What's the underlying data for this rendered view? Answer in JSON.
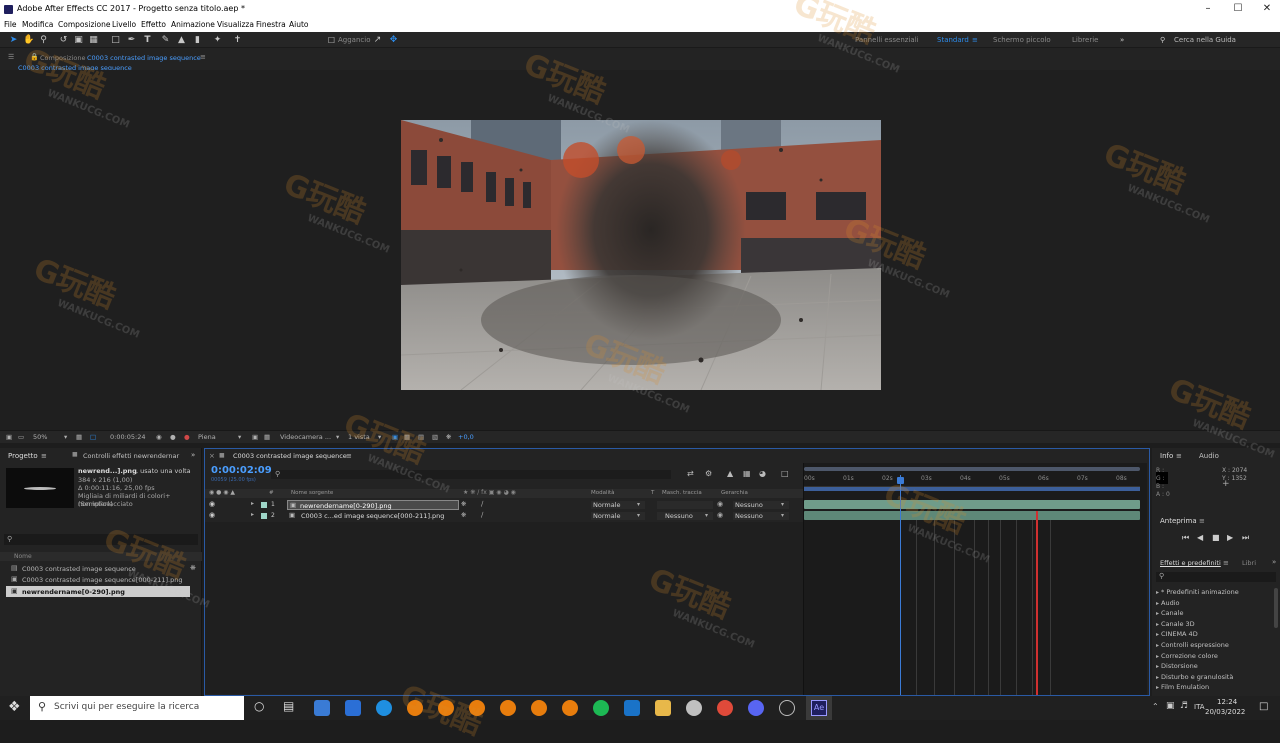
{
  "titlebar": {
    "title": "Adobe After Effects CC 2017 - Progetto senza titolo.aep *"
  },
  "menu": [
    "File",
    "Modifica",
    "Composizione",
    "Livello",
    "Effetto",
    "Animazione",
    "Visualizza",
    "Finestra",
    "Aiuto"
  ],
  "toolbar": {
    "snap_label": "Aggancio",
    "workspaces": [
      "Pannelli essenziali",
      "Standard",
      "Schermo piccolo",
      "Librerie"
    ],
    "search_placeholder": "Cerca nella Guida"
  },
  "composition": {
    "panel_label": "Composizione",
    "comp_name": "C0003 contrasted image sequence",
    "breadcrumb": "C0003 contrasted image sequence"
  },
  "viewer": {
    "zoom": "50%",
    "timecode": "0:00:05:24",
    "resolution": "Piena",
    "camera": "Videocamera ...",
    "views": "1 vista",
    "exposure": "+0,0"
  },
  "project": {
    "tabs": [
      "Progetto",
      "Controlli effetti newrendernar"
    ],
    "selected_name": "newrend...].png",
    "used": ", usato una volta",
    "info_lines": [
      "384 x 216 (1,00)",
      "Δ 0:00:11:16, 25,00 fps",
      "Migliaia di miliardi di colori+ (Semplice)",
      "non interlacciato"
    ],
    "column": "Nome",
    "items": [
      "C0003 contrasted image sequence",
      "C0003 contrasted image sequence[000-211].png",
      "newrendername[0-290].png"
    ]
  },
  "timeline": {
    "tab": "C0003 contrasted image sequence",
    "current_time": "0:00:02:09",
    "fps_line": "00059 (25.00 fps)",
    "columns": [
      "#",
      "Nome sorgente",
      "Modalità",
      "T",
      "Masch. traccia",
      "Gerarchia"
    ],
    "layers": [
      {
        "num": "1",
        "name": "newrendername[0-290].png",
        "mode": "Normale",
        "trkmat": "",
        "parent": "Nessuno"
      },
      {
        "num": "2",
        "name": "C0003 c...ed image sequence[000-211].png",
        "mode": "Normale",
        "trkmat": "Nessuno",
        "parent": "Nessuno"
      }
    ],
    "ruler": [
      "00s",
      "01s",
      "02s",
      "03s",
      "04s",
      "05s",
      "06s",
      "07s",
      "08s"
    ],
    "playhead_seconds": 2.36,
    "total_seconds": 8.5
  },
  "info": {
    "tabs": [
      "Info",
      "Audio"
    ],
    "channels": [
      "R :",
      "G :",
      "B :",
      "A : 0"
    ],
    "x": "X : 2074",
    "y": "Y : 1352"
  },
  "preview": {
    "label": "Anteprima"
  },
  "effects": {
    "tabs": [
      "Effetti e predefiniti",
      "Libri"
    ],
    "items": [
      "* Predefiniti animazione",
      "Audio",
      "Canale",
      "Canale 3D",
      "CINEMA 4D",
      "Controlli espressione",
      "Correzione colore",
      "Distorsione",
      "Disturbo e granulosità",
      "Film Emulation"
    ]
  },
  "taskbar": {
    "search_placeholder": "Scrivi qui per eseguire la ricerca",
    "lang": "ITA",
    "time": "12:24",
    "date": "20/03/2022"
  },
  "watermark": {
    "logo": "G玩酷",
    "site": "WANKUCG.COM"
  },
  "colors": {
    "accent": "#2d8ceb",
    "timecode": "#4a9eff",
    "layer_bar": "#6f9c8a",
    "playhead": "#3b7bd6",
    "marker": "#d03030"
  }
}
